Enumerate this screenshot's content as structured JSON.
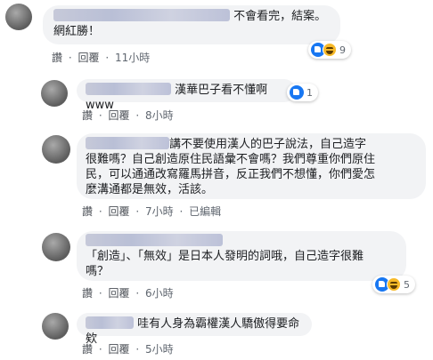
{
  "comments": [
    {
      "text_after_name": "不會看完，結案。",
      "line2": "網紅勝！",
      "actions": {
        "read": "讚",
        "reply": "回覆",
        "time": "11小時"
      },
      "reactions": {
        "count": "9",
        "icons": [
          "like-icon",
          "haha-icon"
        ]
      }
    },
    {
      "text": "漢華巴子看不懂啊www",
      "actions": {
        "read": "讚",
        "reply": "回覆",
        "time": "8小時"
      },
      "reactions": {
        "count": "1",
        "icons": [
          "like-icon"
        ]
      }
    },
    {
      "line1_after_name": "講不要使用漢人的巴子說法，自己造字",
      "line2": "很難嗎？自己創造原住民語彙不會嗎？我們尊重你們原住",
      "line3": "民，可以通通改寫羅馬拼音，反正我們不想懂，你們愛怎",
      "line4": "麼溝通都是無效，活該。",
      "actions": {
        "read": "讚",
        "reply": "回覆",
        "time": "7小時",
        "edited": "已編輯"
      }
    },
    {
      "line1": "「創造」、「無效」是日本人發明的詞哦，自己造字很難",
      "line2": "嗎？",
      "actions": {
        "read": "讚",
        "reply": "回覆",
        "time": "6小時"
      },
      "reactions": {
        "count": "5",
        "icons": [
          "like-icon",
          "haha-icon"
        ]
      }
    },
    {
      "text_after_name": "哇有人身為霸權漢人驕傲得要命欸",
      "actions": {
        "read": "讚",
        "reply": "回覆",
        "time": "5小時"
      }
    }
  ]
}
